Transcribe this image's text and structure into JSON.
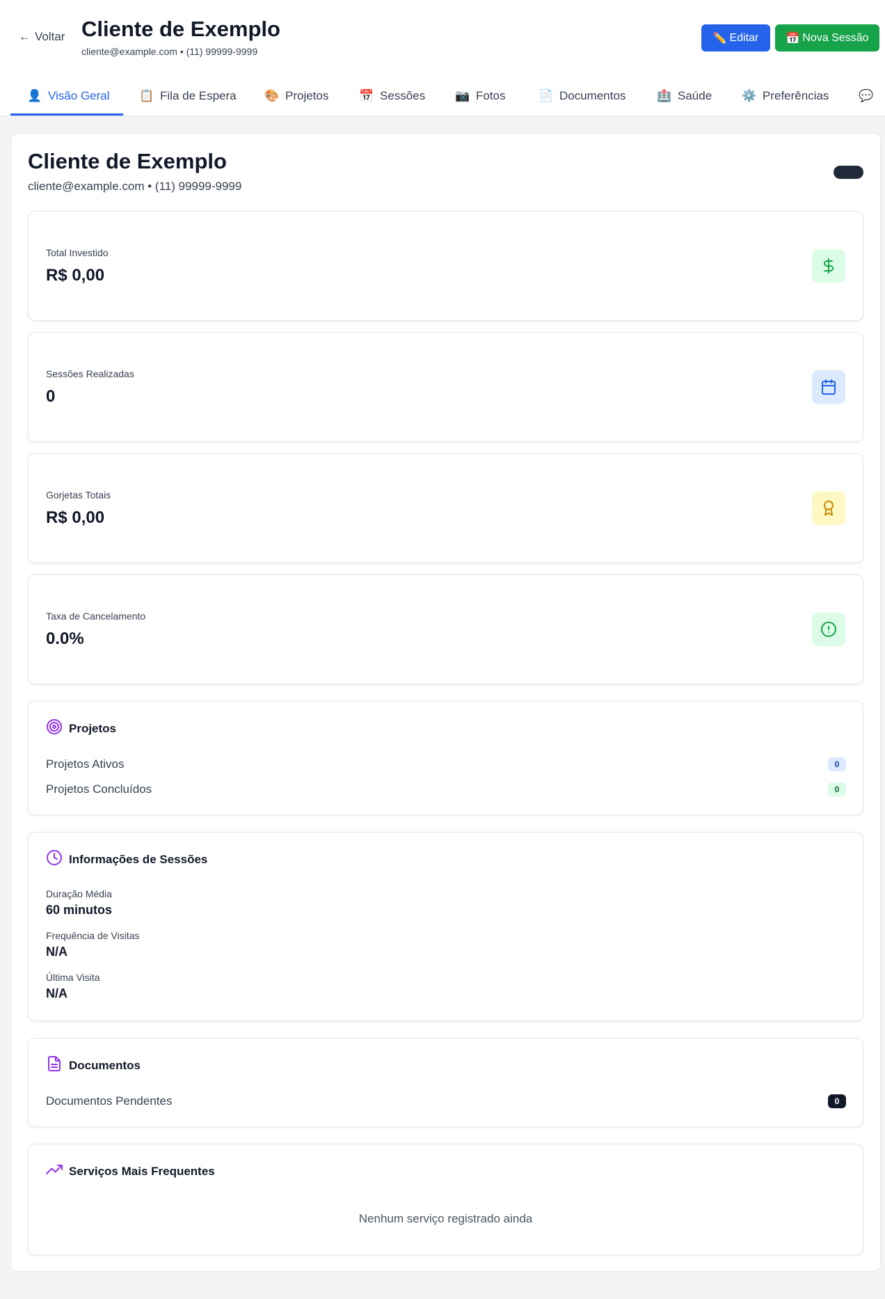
{
  "header": {
    "back_label": "Voltar",
    "title": "Cliente de Exemplo",
    "subtitle": "cliente@example.com • (11) 99999-9999",
    "edit_label": "Editar",
    "new_session_label": "Nova Sessão"
  },
  "tabs": [
    {
      "label": "Visão Geral",
      "icon": "person-icon",
      "active": true
    },
    {
      "label": "Fila de Espera",
      "icon": "clipboard-icon"
    },
    {
      "label": "Projetos",
      "icon": "palette-icon"
    },
    {
      "label": "Sessões",
      "icon": "calendar-icon"
    },
    {
      "label": "Fotos",
      "icon": "camera-icon"
    },
    {
      "label": "Documentos",
      "icon": "document-icon"
    },
    {
      "label": "Saúde",
      "icon": "hospital-icon"
    },
    {
      "label": "Preferências",
      "icon": "gear-icon"
    }
  ],
  "overview": {
    "name": "Cliente de Exemplo",
    "contact": "cliente@example.com • (11) 99999-9999"
  },
  "stats": [
    {
      "label": "Total Investido",
      "value": "R$ 0,00",
      "icon": "dollar-icon",
      "color": "#16a34a",
      "bg": "#dcfce7"
    },
    {
      "label": "Sessões Realizadas",
      "value": "0",
      "icon": "calendar-icon",
      "color": "#2563eb",
      "bg": "#dbeafe"
    },
    {
      "label": "Gorjetas Totais",
      "value": "R$ 0,00",
      "icon": "award-icon",
      "color": "#ca8a04",
      "bg": "#fef9c3"
    },
    {
      "label": "Taxa de Cancelamento",
      "value": "0.0%",
      "icon": "alert-circle-icon",
      "color": "#16a34a",
      "bg": "#dcfce7"
    }
  ],
  "projects": {
    "title": "Projetos",
    "active_label": "Projetos Ativos",
    "active_count": "0",
    "done_label": "Projetos Concluídos",
    "done_count": "0"
  },
  "sessions_info": {
    "title": "Informações de Sessões",
    "avg_label": "Duração Média",
    "avg_value": "60 minutos",
    "freq_label": "Frequência de Visitas",
    "freq_value": "N/A",
    "last_label": "Última Visita",
    "last_value": "N/A"
  },
  "documents": {
    "title": "Documentos",
    "pending_label": "Documentos Pendentes",
    "pending_count": "0"
  },
  "services": {
    "title": "Serviços Mais Frequentes",
    "empty": "Nenhum serviço registrado ainda"
  },
  "colors": {
    "primary": "#2563eb",
    "success": "#16a34a",
    "accent_purple": "#9333ea"
  }
}
